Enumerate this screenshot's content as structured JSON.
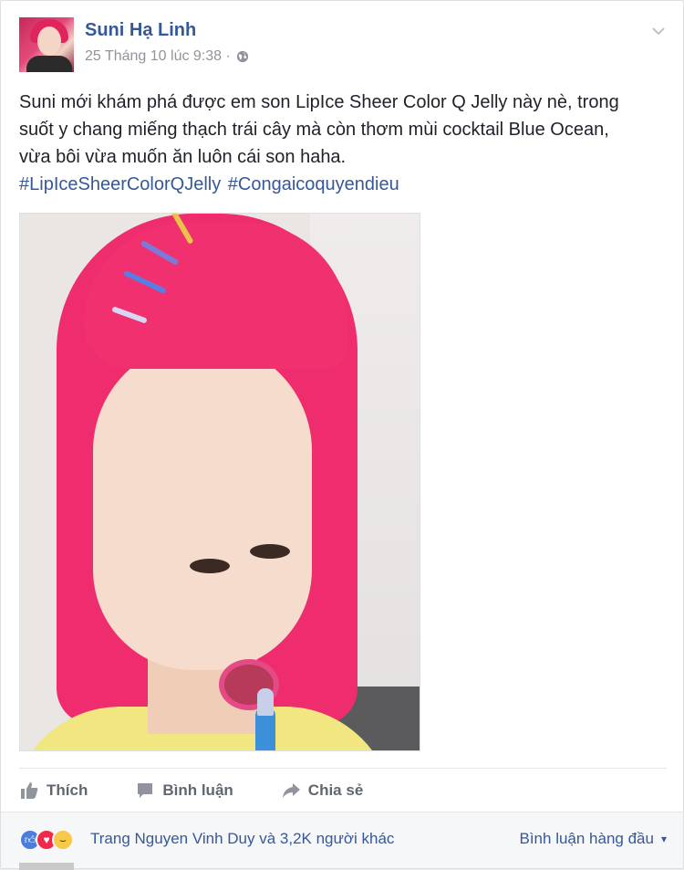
{
  "post": {
    "author": "Suni Hạ Linh",
    "timestamp": "25 Tháng 10 lúc 9:38 ·",
    "privacy_icon": "globe-icon",
    "menu_icon": "chevron-down-icon",
    "text_lines": [
      "Suni mới khám phá được em son LipIce Sheer Color Q Jelly này nè, trong",
      "suốt y chang miếng thạch trái cây mà còn thơm mùi cocktail Blue Ocean,",
      "vừa bôi vừa muốn ăn luôn cái son haha."
    ],
    "hashtags": [
      "#LipIceSheerColorQJelly",
      "#Congaicoquyendieu"
    ]
  },
  "actions": {
    "like_label": "Thích",
    "comment_label": "Bình luận",
    "share_label": "Chia sẻ"
  },
  "reactions": {
    "icons": [
      "like-icon",
      "love-icon",
      "haha-icon"
    ],
    "summary": "Trang Nguyen Vinh Duy và 3,2K người khác",
    "top_comments": "Bình luận hàng đầu",
    "colors": {
      "like": "#4a7dde",
      "love": "#f0284a",
      "haha": "#f7c948"
    }
  },
  "colors": {
    "link": "#365899",
    "meta": "#90949c",
    "action": "#616770"
  }
}
